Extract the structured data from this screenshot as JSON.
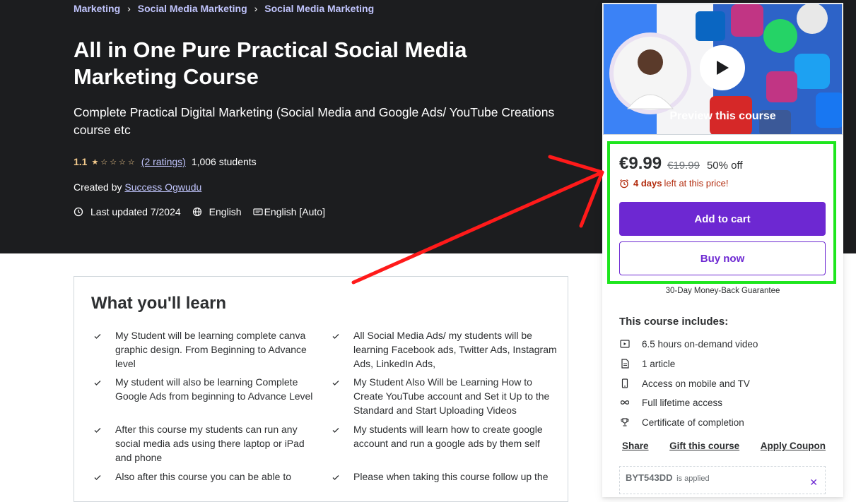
{
  "breadcrumb": {
    "items": [
      "Marketing",
      "Social Media Marketing",
      "Social Media Marketing"
    ]
  },
  "course": {
    "title": "All in One Pure Practical Social Media Marketing Course",
    "subtitle": "Complete Practical Digital Marketing (Social Media and Google Ads/ YouTube Creations course etc",
    "rating": "1.1",
    "stars_filled": 1.1,
    "ratings_count": "(2 ratings)",
    "students": "1,006 students",
    "created_by_label": "Created by",
    "author": "Success Ogwudu",
    "last_updated": "Last updated 7/2024",
    "language": "English",
    "captions": "English [Auto]"
  },
  "learn": {
    "title": "What you'll learn",
    "items": [
      "My Student will be learning complete canva graphic design. From Beginning to Advance level",
      "All Social Media Ads/ my students will be learning Facebook ads, Twitter Ads, Instagram Ads, LinkedIn Ads,",
      "My student will also be learning Complete Google Ads from beginning to Advance Level",
      "My Student Also Will be Learning How to Create YouTube account and Set it Up to the Standard and Start Uploading Videos",
      "After this course my students can run any social media ads using there laptop or iPad and phone",
      "My students will learn how to create google account and run a google ads by them self",
      "Also after this course you can be able to",
      "Please when taking this course follow up the"
    ]
  },
  "sidebar": {
    "preview_label": "Preview this course",
    "price": "€9.99",
    "original_price": "€19.99",
    "discount": "50% off",
    "timer_bold": "4 days",
    "timer_rest": "left at this price!",
    "add_to_cart": "Add to cart",
    "buy_now": "Buy now",
    "guarantee": "30-Day Money-Back Guarantee",
    "includes_title": "This course includes:",
    "includes": [
      {
        "icon": "video-icon",
        "label": "6.5 hours on-demand video"
      },
      {
        "icon": "article-icon",
        "label": "1 article"
      },
      {
        "icon": "mobile-icon",
        "label": "Access on mobile and TV"
      },
      {
        "icon": "infinity-icon",
        "label": "Full lifetime access"
      },
      {
        "icon": "trophy-icon",
        "label": "Certificate of completion"
      }
    ],
    "links": {
      "share": "Share",
      "gift": "Gift this course",
      "coupon": "Apply Coupon"
    },
    "coupon_code": "BYT543DD",
    "coupon_note": "is applied"
  },
  "colors": {
    "hero_bg": "#1c1d1f",
    "accent_purple": "#6d28d2",
    "link_lavender": "#c0c4fc",
    "star_gold": "#f3ca8c",
    "timer_red": "#b32d0f",
    "highlight_green": "#1ee61e",
    "annotation_red": "#ff1a1a"
  }
}
